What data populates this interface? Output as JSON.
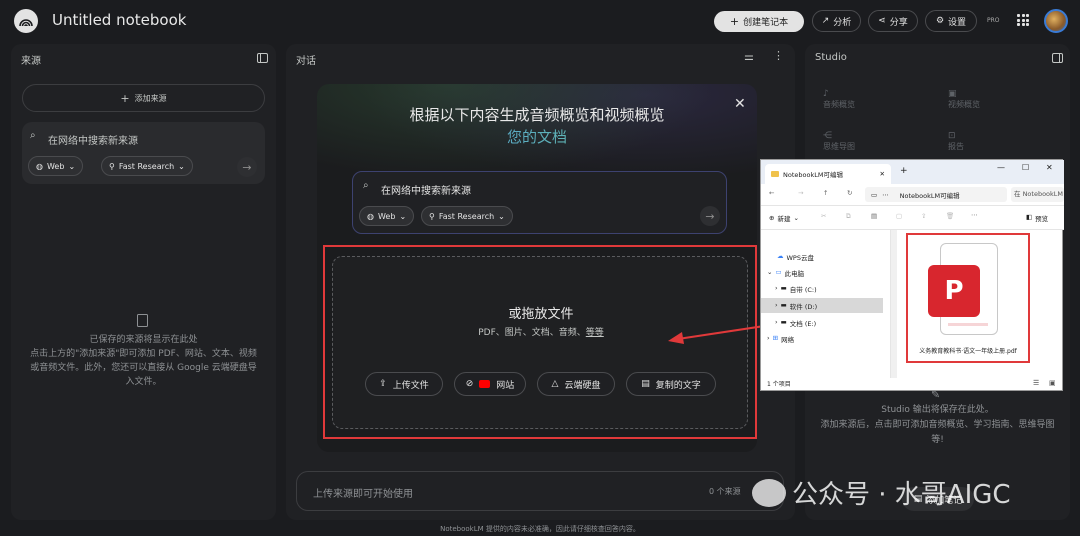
{
  "app": {
    "title": "Untitled notebook",
    "create_button": "创建笔记本",
    "analyze_button": "分析",
    "share_button": "分享",
    "settings_button": "设置",
    "pro_badge": "PRO"
  },
  "sources": {
    "header": "来源",
    "add_button": "添加来源",
    "search_placeholder": "在网络中搜索新来源",
    "web_chip": "Web",
    "research_chip": "Fast Research",
    "empty_line1": "已保存的来源将显示在此处",
    "empty_line2": "点击上方的\"添加来源\"即可添加 PDF、网站、文本、视频",
    "empty_line3": "或音频文件。此外，您还可以直接从 Google 云端硬盘导",
    "empty_line4": "入文件。"
  },
  "chat": {
    "header": "对话",
    "input_placeholder": "上传来源即可开始使用",
    "source_count": "0 个来源",
    "footer_note": "NotebookLM 提供的内容未必准确，因此请仔细核查回答内容。"
  },
  "modal": {
    "title": "根据以下内容生成音频概览和视频概览",
    "subtitle": "您的文档",
    "search_placeholder": "在网络中搜索新来源",
    "web_chip": "Web",
    "research_chip": "Fast Research",
    "drop_title": "或拖放文件",
    "drop_types": "PDF、图片、文档、音频、",
    "drop_more": "等等",
    "upload_button": "上传文件",
    "website_button": "网站",
    "drive_button": "云端硬盘",
    "paste_button": "复制的文字"
  },
  "studio": {
    "header": "Studio",
    "items": [
      "音频概览",
      "视频概览",
      "思维导图",
      "报告"
    ],
    "empty_line1": "Studio 输出将保存在此处。",
    "empty_line2": "添加来源后，点击即可添加音频概览、学习指南、思维导图",
    "empty_line3": "等!",
    "add_note": "添加笔记"
  },
  "explorer": {
    "tab_title": "NotebookLM可编辑",
    "address": "NotebookLM可编辑",
    "search_placeholder": "在 NotebookLM",
    "new_button": "新建",
    "preview_button": "预览",
    "tree": [
      "WPS云盘",
      "此电脑",
      "自带 (C:)",
      "软件 (D:)",
      "文档 (E:)",
      "网络"
    ],
    "file_name": "义务教育教科书·语文一年级上册.pdf",
    "status": "1 个项目"
  },
  "watermark": "公众号 · 水哥AIGC",
  "colors": {
    "highlight_red": "#e0393a",
    "pdf_red": "#d8262e",
    "subtitle_gradient_start": "#4a8ff0",
    "subtitle_gradient_end": "#6fd08a"
  }
}
